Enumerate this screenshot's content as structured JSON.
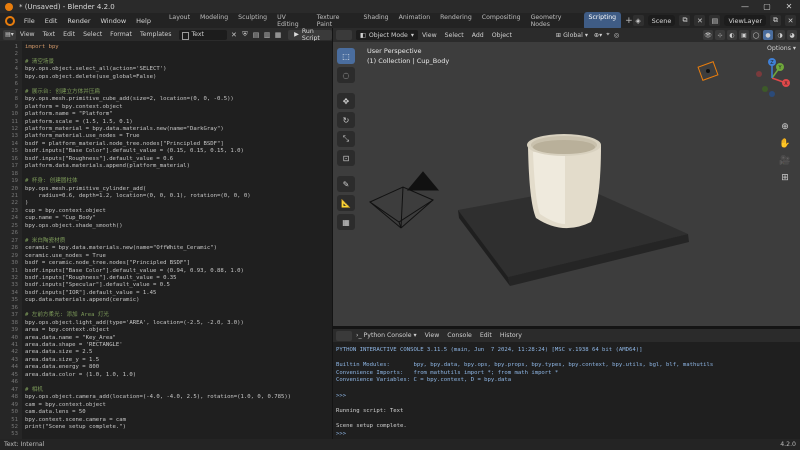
{
  "window": {
    "title": "* (Unsaved) - Blender 4.2.0",
    "minimize": "—",
    "maximize": "▢",
    "close": "✕"
  },
  "menu": [
    "File",
    "Edit",
    "Render",
    "Window",
    "Help"
  ],
  "workspaces": [
    {
      "label": "Layout",
      "active": false
    },
    {
      "label": "Modeling",
      "active": false
    },
    {
      "label": "Sculpting",
      "active": false
    },
    {
      "label": "UV Editing",
      "active": false
    },
    {
      "label": "Texture Paint",
      "active": false
    },
    {
      "label": "Shading",
      "active": false
    },
    {
      "label": "Animation",
      "active": false
    },
    {
      "label": "Rendering",
      "active": false
    },
    {
      "label": "Compositing",
      "active": false
    },
    {
      "label": "Geometry Nodes",
      "active": false
    },
    {
      "label": "Scripting",
      "active": true
    }
  ],
  "workspace_add": "+",
  "scene": {
    "label": "Scene",
    "view_layer": "ViewLayer"
  },
  "text_editor": {
    "menus": [
      "View",
      "Text",
      "Edit",
      "Select",
      "Format",
      "Templates"
    ],
    "text_name": "Text",
    "run_label": "Run Script",
    "lines": [
      {
        "n": "1",
        "text": "import bpy",
        "type": "kw"
      },
      {
        "n": "2",
        "text": "",
        "type": "code"
      },
      {
        "n": "3",
        "text": "# 清空场景",
        "type": "comment"
      },
      {
        "n": "4",
        "text": "bpy.ops.object.select_all(action='SELECT')",
        "type": "code"
      },
      {
        "n": "5",
        "text": "bpy.ops.object.delete(use_global=False)",
        "type": "code"
      },
      {
        "n": "6",
        "text": "",
        "type": "code"
      },
      {
        "n": "7",
        "text": "# 展示台: 创建立方体并压扁",
        "type": "comment"
      },
      {
        "n": "8",
        "text": "bpy.ops.mesh.primitive_cube_add(size=2, location=(0, 0, -0.5))",
        "type": "code"
      },
      {
        "n": "9",
        "text": "platform = bpy.context.object",
        "type": "code"
      },
      {
        "n": "10",
        "text": "platform.name = \"Platform\"",
        "type": "code"
      },
      {
        "n": "11",
        "text": "platform.scale = (1.5, 1.5, 0.1)",
        "type": "code"
      },
      {
        "n": "12",
        "text": "platform_material = bpy.data.materials.new(name=\"DarkGray\")",
        "type": "code"
      },
      {
        "n": "13",
        "text": "platform_material.use_nodes = True",
        "type": "code"
      },
      {
        "n": "14",
        "text": "bsdf = platform_material.node_tree.nodes[\"Principled BSDF\"]",
        "type": "code"
      },
      {
        "n": "15",
        "text": "bsdf.inputs[\"Base Color\"].default_value = (0.15, 0.15, 0.15, 1.0)",
        "type": "code"
      },
      {
        "n": "16",
        "text": "bsdf.inputs[\"Roughness\"].default_value = 0.6",
        "type": "code"
      },
      {
        "n": "17",
        "text": "platform.data.materials.append(platform_material)",
        "type": "code"
      },
      {
        "n": "18",
        "text": "",
        "type": "code"
      },
      {
        "n": "19",
        "text": "# 杯身: 创建圆柱体",
        "type": "comment"
      },
      {
        "n": "20",
        "text": "bpy.ops.mesh.primitive_cylinder_add(",
        "type": "code"
      },
      {
        "n": "21",
        "text": "    radius=0.6, depth=1.2, location=(0, 0, 0.1), rotation=(0, 0, 0)",
        "type": "code"
      },
      {
        "n": "22",
        "text": ")",
        "type": "code"
      },
      {
        "n": "23",
        "text": "cup = bpy.context.object",
        "type": "code"
      },
      {
        "n": "24",
        "text": "cup.name = \"Cup_Body\"",
        "type": "code"
      },
      {
        "n": "25",
        "text": "bpy.ops.object.shade_smooth()",
        "type": "code"
      },
      {
        "n": "26",
        "text": "",
        "type": "code"
      },
      {
        "n": "27",
        "text": "# 米白陶瓷材质",
        "type": "comment"
      },
      {
        "n": "28",
        "text": "ceramic = bpy.data.materials.new(name=\"OffWhite_Ceramic\")",
        "type": "code"
      },
      {
        "n": "29",
        "text": "ceramic.use_nodes = True",
        "type": "code"
      },
      {
        "n": "30",
        "text": "bsdf = ceramic.node_tree.nodes[\"Principled BSDF\"]",
        "type": "code"
      },
      {
        "n": "31",
        "text": "bsdf.inputs[\"Base Color\"].default_value = (0.94, 0.93, 0.88, 1.0)",
        "type": "code"
      },
      {
        "n": "32",
        "text": "bsdf.inputs[\"Roughness\"].default_value = 0.35",
        "type": "code"
      },
      {
        "n": "33",
        "text": "bsdf.inputs[\"Specular\"].default_value = 0.5",
        "type": "code"
      },
      {
        "n": "34",
        "text": "bsdf.inputs[\"IOR\"].default_value = 1.45",
        "type": "code"
      },
      {
        "n": "35",
        "text": "cup.data.materials.append(ceramic)",
        "type": "code"
      },
      {
        "n": "36",
        "text": "",
        "type": "code"
      },
      {
        "n": "37",
        "text": "# 左前方柔光: 添加 Area 灯光",
        "type": "comment"
      },
      {
        "n": "38",
        "text": "bpy.ops.object.light_add(type='AREA', location=(-2.5, -2.0, 3.0))",
        "type": "code"
      },
      {
        "n": "39",
        "text": "area = bpy.context.object",
        "type": "code"
      },
      {
        "n": "40",
        "text": "area.data.name = \"Key_Area\"",
        "type": "code"
      },
      {
        "n": "41",
        "text": "area.data.shape = 'RECTANGLE'",
        "type": "code"
      },
      {
        "n": "42",
        "text": "area.data.size = 2.5",
        "type": "code"
      },
      {
        "n": "43",
        "text": "area.data.size_y = 1.5",
        "type": "code"
      },
      {
        "n": "44",
        "text": "area.data.energy = 800",
        "type": "code"
      },
      {
        "n": "45",
        "text": "area.data.color = (1.0, 1.0, 1.0)",
        "type": "code"
      },
      {
        "n": "46",
        "text": "",
        "type": "code"
      },
      {
        "n": "47",
        "text": "# 相机",
        "type": "comment"
      },
      {
        "n": "48",
        "text": "bpy.ops.object.camera_add(location=(-4.0, -4.0, 2.5), rotation=(1.0, 0, 0.785))",
        "type": "code"
      },
      {
        "n": "49",
        "text": "cam = bpy.context.object",
        "type": "code"
      },
      {
        "n": "50",
        "text": "cam.data.lens = 50",
        "type": "code"
      },
      {
        "n": "51",
        "text": "bpy.context.scene.camera = cam",
        "type": "code"
      },
      {
        "n": "52",
        "text": "print(\"Scene setup complete.\")",
        "type": "code"
      },
      {
        "n": "53",
        "text": "",
        "type": "code"
      }
    ]
  },
  "viewport": {
    "mode": "Object Mode",
    "menus": [
      "View",
      "Select",
      "Add",
      "Object"
    ],
    "orientation": "Global",
    "view_name": "User Perspective",
    "collection": "(1) Collection | Cup_Body",
    "options_label": "Options",
    "gizmo_x": "X",
    "gizmo_y": "Y",
    "gizmo_z": "Z",
    "colors": {
      "x": "#e0484a",
      "y": "#6fa83b",
      "z": "#3f80d6",
      "cup": "#e9e4d6",
      "platform": "#2c2c2c"
    }
  },
  "console": {
    "type_label": "Python Console",
    "menus": [
      "View",
      "Console",
      "Edit",
      "History"
    ],
    "lines": [
      {
        "text": "PYTHON INTERACTIVE CONSOLE 3.11.5 (main, Jun  7 2024, 11:28:24) [MSC v.1938 64 bit (AMD64)]",
        "type": "info"
      },
      {
        "text": "",
        "type": "info"
      },
      {
        "text": "Builtin Modules:       bpy, bpy.data, bpy.ops, bpy.props, bpy.types, bpy.context, bpy.utils, bgl, blf, mathutils",
        "type": "info"
      },
      {
        "text": "Convenience Imports:   from mathutils import *; from math import *",
        "type": "info"
      },
      {
        "text": "Convenience Variables: C = bpy.context, D = bpy.data",
        "type": "info"
      },
      {
        "text": "",
        "type": "info"
      },
      {
        "text": ">>>",
        "type": "info"
      },
      {
        "text": "",
        "type": "out"
      },
      {
        "text": "Running script: Text",
        "type": "out"
      },
      {
        "text": "",
        "type": "out"
      },
      {
        "text": "Scene setup complete.",
        "type": "out"
      },
      {
        "text": ">>>",
        "type": "info"
      }
    ]
  },
  "status": {
    "left": "Text: Internal",
    "version": "4.2.0"
  }
}
